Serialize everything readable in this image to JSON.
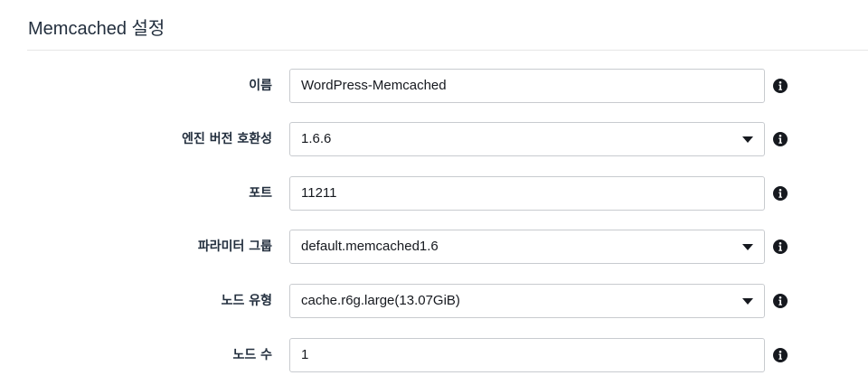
{
  "section": {
    "title": "Memcached 설정"
  },
  "fields": [
    {
      "label": "이름",
      "value": "WordPress-Memcached",
      "type": "text"
    },
    {
      "label": "엔진 버전 호환성",
      "value": "1.6.6",
      "type": "select"
    },
    {
      "label": "포트",
      "value": "11211",
      "type": "text"
    },
    {
      "label": "파라미터 그룹",
      "value": "default.memcached1.6",
      "type": "select"
    },
    {
      "label": "노드 유형",
      "value": "cache.r6g.large(13.07GiB)",
      "type": "select"
    },
    {
      "label": "노드 수",
      "value": "1",
      "type": "text"
    }
  ],
  "icons": {
    "info": "info-circle-icon",
    "dropdown": "caret-down-icon"
  },
  "colors": {
    "text": "#16191f",
    "heading": "#232f3e",
    "border": "#c8cbcf",
    "divider": "#e6e6e6"
  }
}
